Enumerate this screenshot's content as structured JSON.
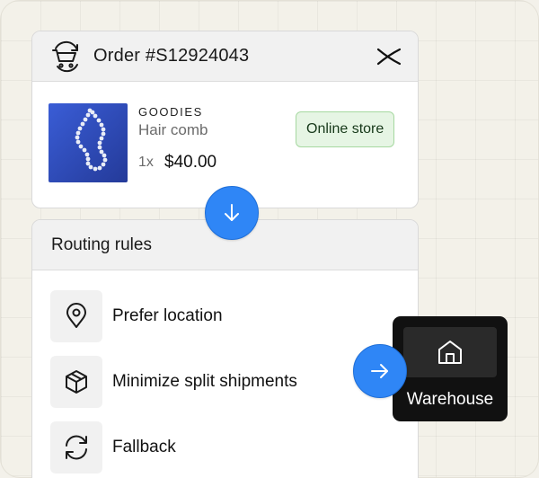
{
  "order": {
    "title": "Order #S12924043",
    "brand": "GOODIES",
    "product_name": "Hair comb",
    "quantity": "1x",
    "price": "$40.00",
    "channel": "Online store"
  },
  "routing": {
    "title": "Routing rules",
    "rules": [
      {
        "label": "Prefer location",
        "icon": "location-pin-icon"
      },
      {
        "label": "Minimize split shipments",
        "icon": "package-icon"
      },
      {
        "label": "Fallback",
        "icon": "refresh-icon"
      }
    ]
  },
  "destination": {
    "label": "Warehouse",
    "icon": "home-icon"
  },
  "colors": {
    "accent_blue": "#2f86f6",
    "badge_green_bg": "#e6f5e4",
    "badge_green_border": "#a6d8a0",
    "dark_card": "#111111"
  }
}
